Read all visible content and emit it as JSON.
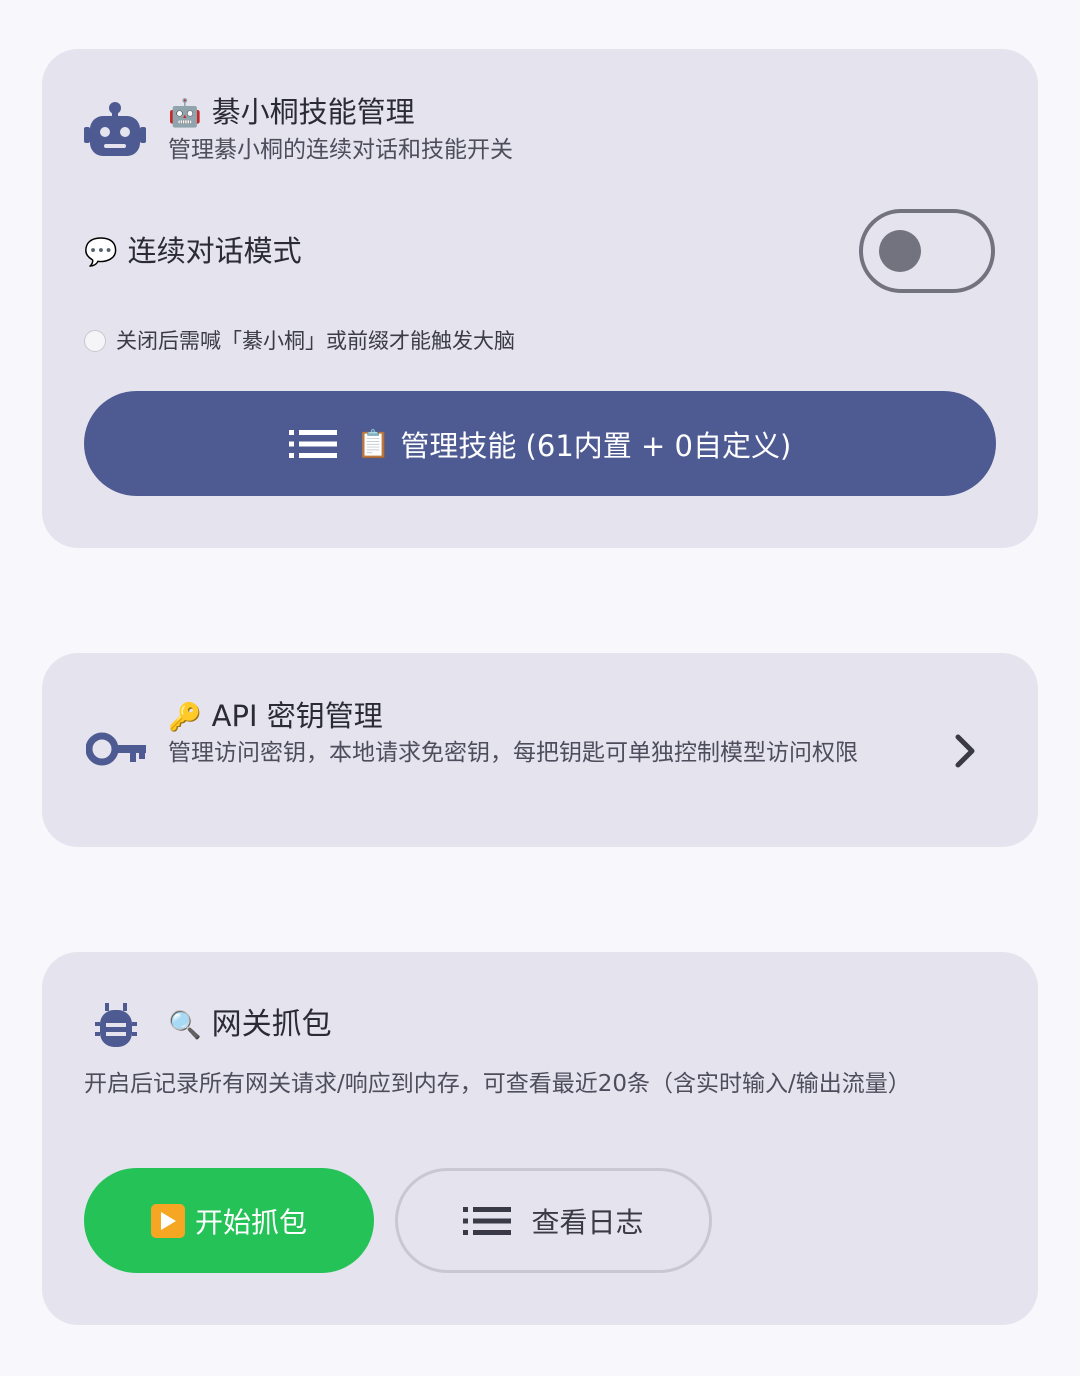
{
  "skills_card": {
    "icon": "robot-icon",
    "title_emoji": "🤖",
    "title": "綦小桐技能管理",
    "subtitle": "管理綦小桐的连续对话和技能开关",
    "continuous_mode": {
      "emoji": "💬",
      "label": "连续对话模式",
      "enabled": false
    },
    "hint": "关闭后需喊「綦小桐」或前缀才能触发大脑",
    "manage_button": {
      "icon": "list-icon",
      "emoji": "📋",
      "label": "管理技能 (61内置 + 0自定义)"
    }
  },
  "api_card": {
    "icon": "key-icon",
    "title_emoji": "🔑",
    "title": "API 密钥管理",
    "subtitle": "管理访问密钥，本地请求免密钥，每把钥匙可单独控制模型访问权限",
    "chevron": "chevron-right-icon"
  },
  "capture_card": {
    "icon": "bug-icon",
    "title_emoji": "🔍",
    "title": "网关抓包",
    "description": "开启后记录所有网关请求/响应到内存，可查看最近20条（含实时输入/输出流量）",
    "start_button": {
      "emoji": "▶️",
      "label": "开始抓包"
    },
    "log_button": {
      "icon": "list-icon",
      "label": "查看日志"
    }
  },
  "colors": {
    "background": "#f7f7fc",
    "card": "#e4e3ee",
    "primary": "#4e5a92",
    "icon": "#4e5a92",
    "success": "#25c258",
    "toggle_off": "#737380"
  }
}
